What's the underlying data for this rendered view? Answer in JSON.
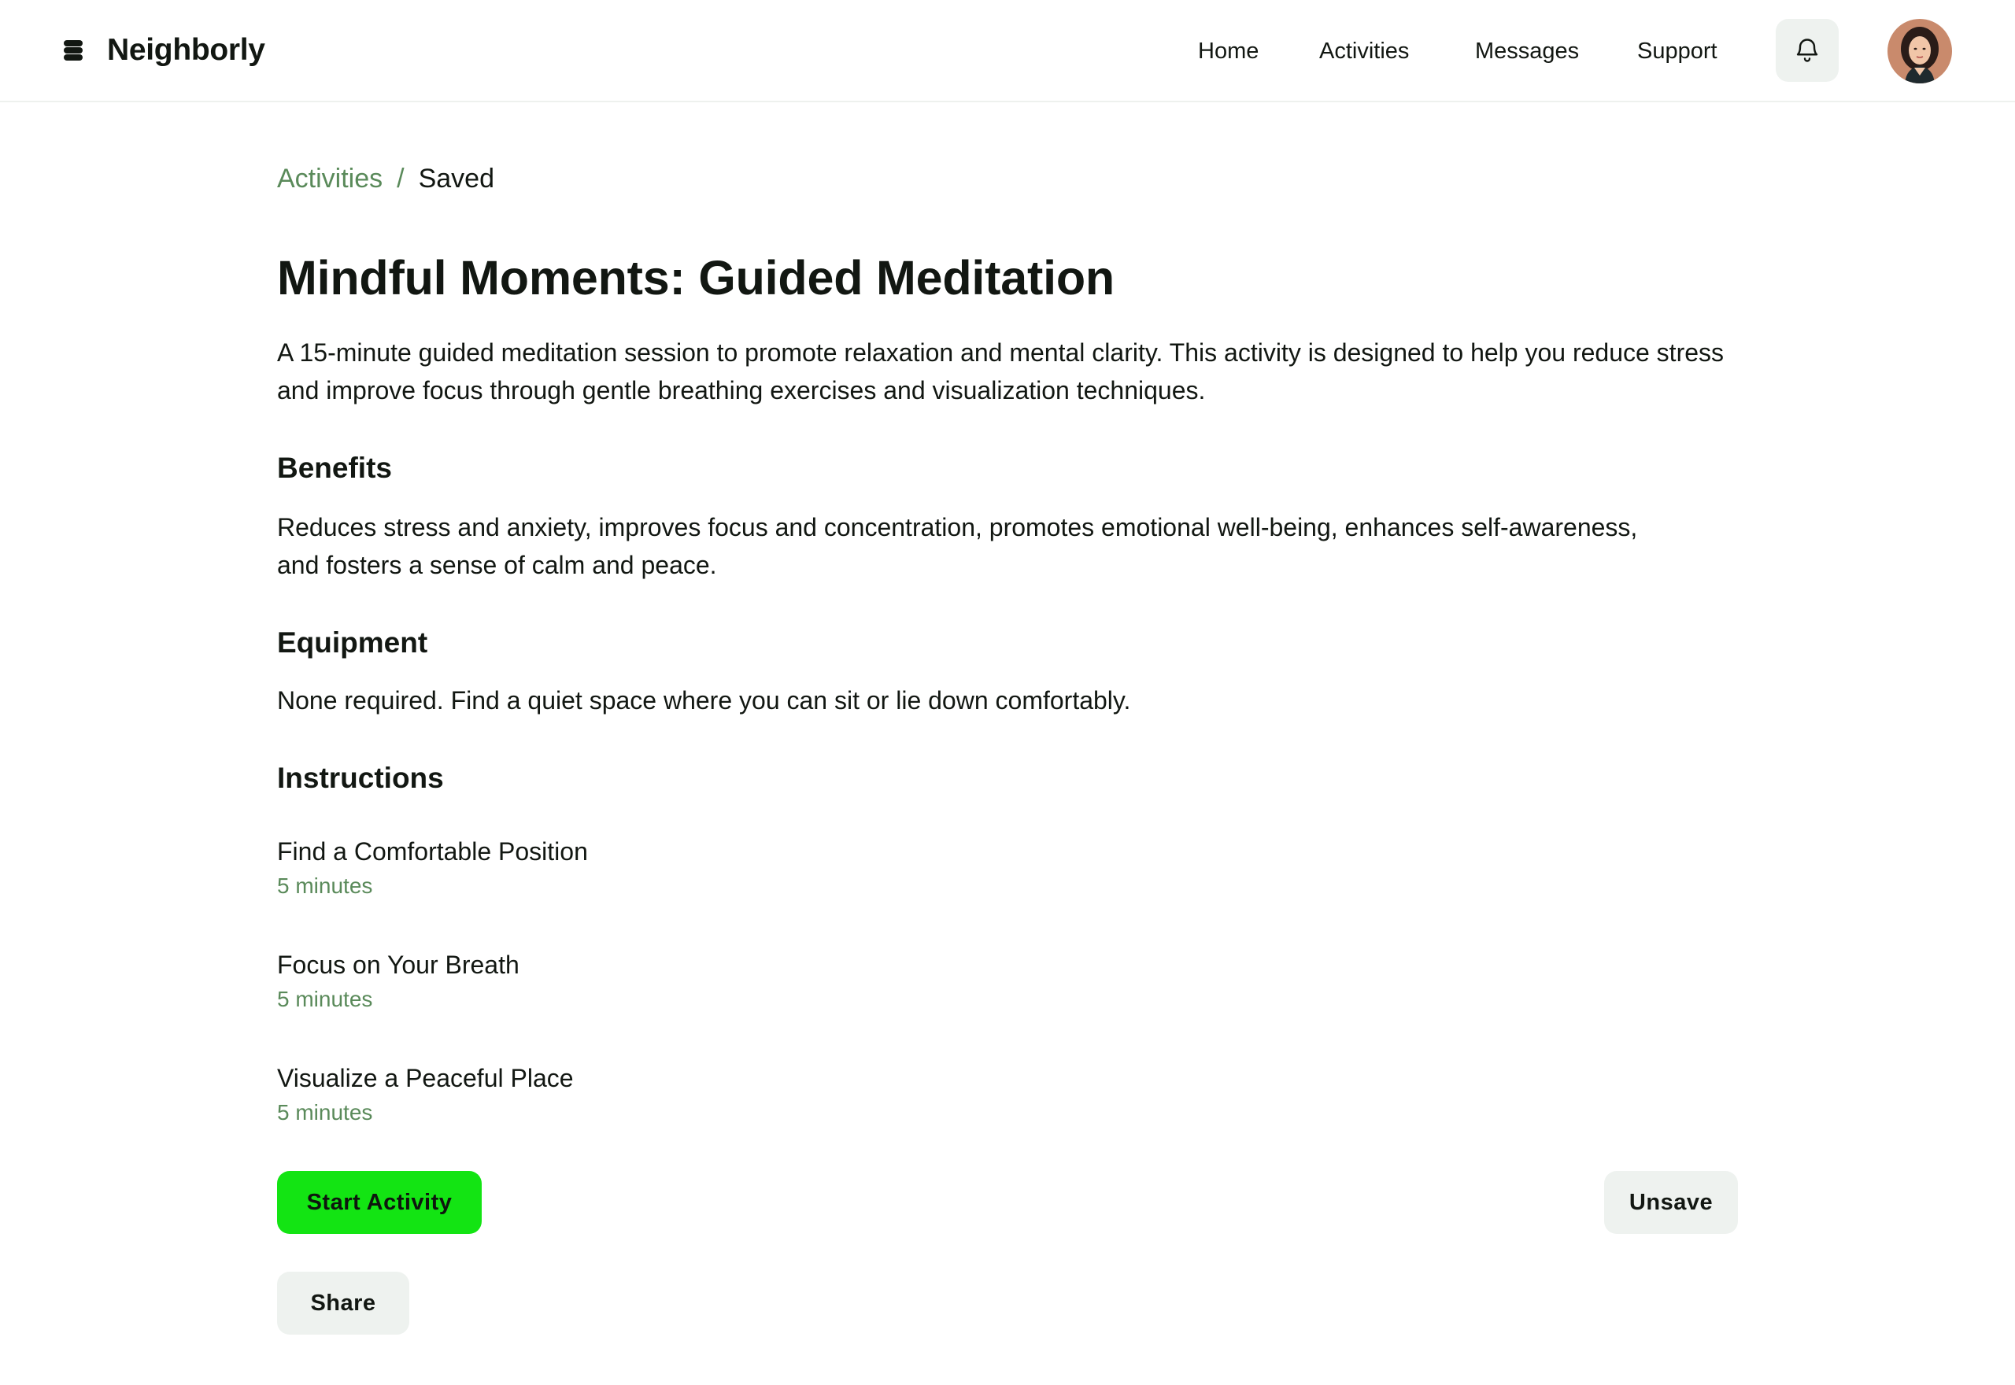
{
  "brand": {
    "name": "Neighborly",
    "icon": "logo-icon"
  },
  "nav": {
    "items": [
      {
        "label": "Home"
      },
      {
        "label": "Activities"
      },
      {
        "label": "Messages"
      },
      {
        "label": "Support"
      }
    ],
    "notifications_icon": "bell-icon",
    "avatar_icon": "user-avatar"
  },
  "breadcrumb": {
    "parent": "Activities",
    "separator": "/",
    "current": "Saved"
  },
  "activity": {
    "title": "Mindful Moments: Guided Meditation",
    "description": "A 15-minute guided meditation session to promote relaxation and mental clarity. This activity is designed to help you reduce stress and improve focus through gentle breathing exercises and visualization techniques.",
    "benefits_heading": "Benefits",
    "benefits_text": "Reduces stress and anxiety, improves focus and concentration, promotes emotional well-being, enhances self-awareness, and fosters a sense of calm and peace.",
    "equipment_heading": "Equipment",
    "equipment_text": "None required. Find a quiet space where you can sit or lie down comfortably.",
    "instructions_heading": "Instructions",
    "steps": [
      {
        "title": "Find a Comfortable Position",
        "duration": "5 minutes"
      },
      {
        "title": "Focus on Your Breath",
        "duration": "5 minutes"
      },
      {
        "title": "Visualize a Peaceful Place",
        "duration": "5 minutes"
      }
    ]
  },
  "actions": {
    "start_label": "Start Activity",
    "unsave_label": "Unsave",
    "share_label": "Share"
  },
  "colors": {
    "accent": "#13e413",
    "muted_green": "#5a8a5a",
    "text": "#121712",
    "secondary_bg": "#eef2ef"
  }
}
